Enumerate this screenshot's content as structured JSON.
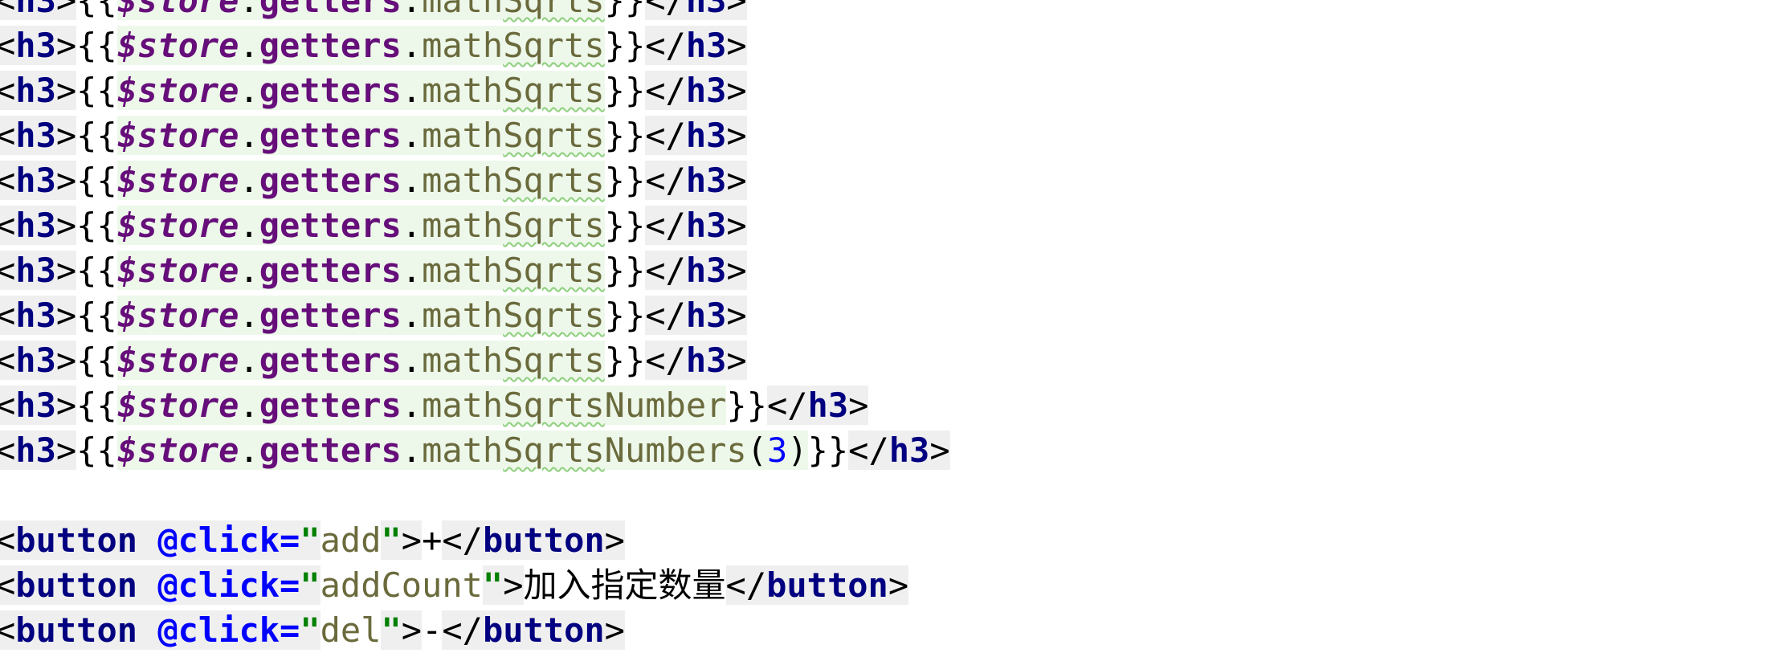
{
  "editor": {
    "lines": [
      {
        "prop": "mathSqrts",
        "suffix": ""
      },
      {
        "prop": "mathSqrts",
        "suffix": ""
      },
      {
        "prop": "mathSqrts",
        "suffix": ""
      },
      {
        "prop": "mathSqrts",
        "suffix": ""
      },
      {
        "prop": "mathSqrts",
        "suffix": ""
      },
      {
        "prop": "mathSqrts",
        "suffix": ""
      },
      {
        "prop": "mathSqrts",
        "suffix": ""
      },
      {
        "prop": "mathSqrts",
        "suffix": ""
      },
      {
        "prop": "mathSqrts",
        "suffix": ""
      },
      {
        "prop": "mathSqrtsNumber",
        "suffix": ""
      },
      {
        "prop": "mathSqrtsNumbers",
        "suffix": "3"
      }
    ],
    "tokens": {
      "h3": "h3",
      "store": "$store",
      "getters": "getters",
      "button": "button",
      "click_attr": "@click="
    },
    "buttons": [
      {
        "handler": "add",
        "text": "+"
      },
      {
        "handler": "addCount",
        "text": "加入指定数量"
      },
      {
        "handler": "del",
        "text": "-"
      }
    ]
  }
}
